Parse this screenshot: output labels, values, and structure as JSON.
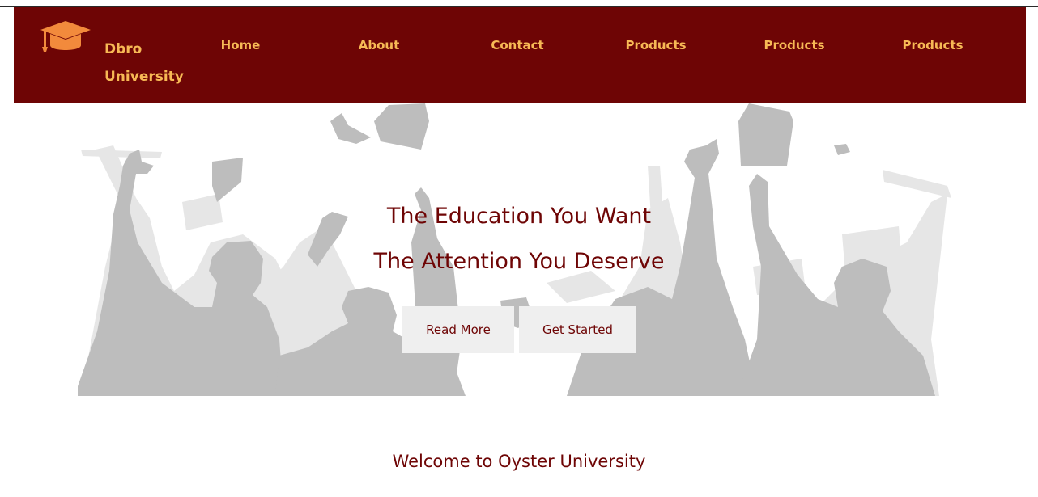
{
  "brand": {
    "name_line1": "Dbro",
    "name_line2": "University",
    "logo_icon": "graduation-cap-icon"
  },
  "nav": {
    "items": [
      {
        "label": "Home"
      },
      {
        "label": "About"
      },
      {
        "label": "Contact"
      },
      {
        "label": "Products"
      },
      {
        "label": "Products"
      },
      {
        "label": "Products"
      }
    ]
  },
  "hero": {
    "background": "graduates-silhouette",
    "headline_1": "The Education You Want",
    "headline_2": "The Attention You Deserve",
    "primary_button": "Read More",
    "secondary_button": "Get Started"
  },
  "welcome": {
    "title": "Welcome to Oyster University"
  },
  "colors": {
    "brand": "#6e0505",
    "accent": "#f7b955",
    "button_bg": "#efefef",
    "silhouette": "#bdbdbd"
  }
}
